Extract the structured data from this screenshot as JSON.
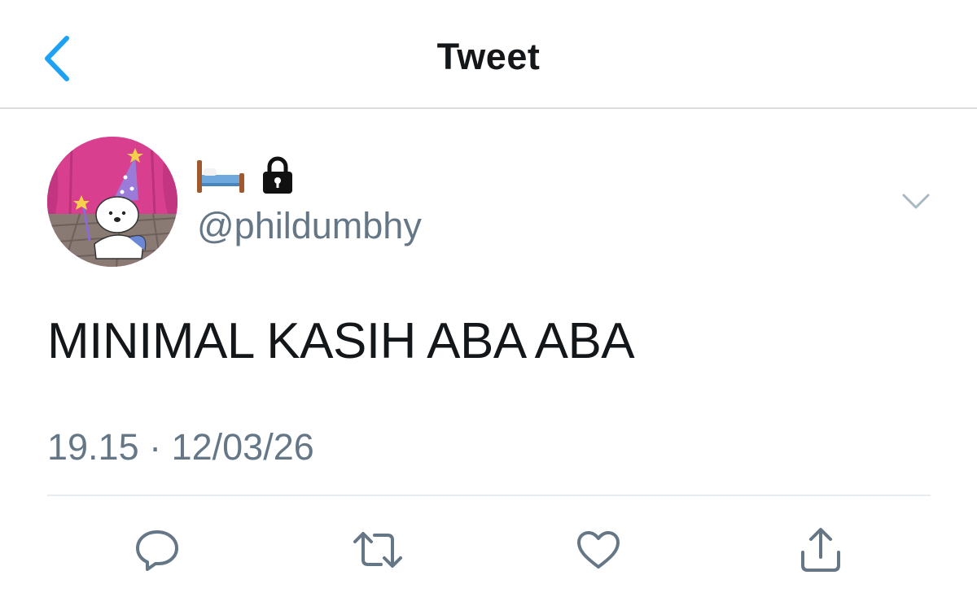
{
  "header": {
    "title": "Tweet",
    "back_icon": "chevron-left-icon",
    "accent_color": "#1da1f2"
  },
  "tweet": {
    "display_name_icons": [
      "bed-emoji-icon",
      "lock-icon"
    ],
    "handle": "@phildumbhy",
    "text": "MINIMAL KASIH ABA ABA",
    "timestamp": "19.15 · 12/03/26",
    "menu_icon": "chevron-down-icon"
  },
  "actions": [
    {
      "name": "reply",
      "icon": "reply-icon"
    },
    {
      "name": "retweet",
      "icon": "retweet-icon"
    },
    {
      "name": "like",
      "icon": "heart-icon"
    },
    {
      "name": "share",
      "icon": "share-icon"
    }
  ],
  "colors": {
    "text_primary": "#14171a",
    "text_secondary": "#657786",
    "icon_gray": "#657786",
    "divider": "#e6ecf0"
  }
}
